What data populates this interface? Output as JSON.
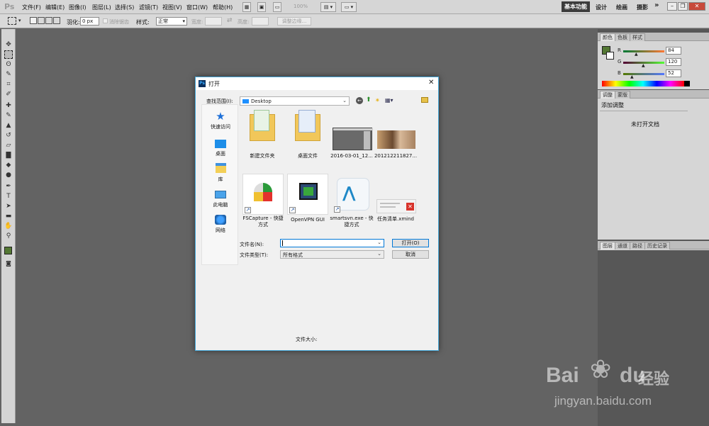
{
  "app": {
    "logo": "Ps",
    "menus": [
      "文件(F)",
      "编辑(E)",
      "图像(I)",
      "图层(L)",
      "选择(S)",
      "滤镜(T)",
      "视图(V)",
      "窗口(W)",
      "帮助(H)"
    ],
    "zoom": "100%",
    "workspaces": {
      "active": "基本功能",
      "items": [
        "设计",
        "绘画",
        "摄影"
      ],
      "more": "»"
    }
  },
  "options": {
    "feather_label": "羽化:",
    "feather_value": "0 px",
    "antialias_label": "消除锯齿",
    "style_label": "样式:",
    "style_value": "正常",
    "width_label": "宽度:",
    "height_label": "高度:",
    "refine_edge": "调整边缘..."
  },
  "panels": {
    "color": {
      "tabs": [
        "颜色",
        "色板",
        "样式"
      ],
      "r": "84",
      "g": "120",
      "b": "52",
      "foreground_color": "#547834"
    },
    "adjustments": {
      "tabs": [
        "调整",
        "蒙版"
      ],
      "heading": "添加调整",
      "empty_message": "未打开文档"
    },
    "layers": {
      "tabs": [
        "图层",
        "通道",
        "路径",
        "历史记录"
      ]
    }
  },
  "dialog": {
    "title": "打开",
    "lookin_label": "查找范围(I):",
    "lookin_value": "Desktop",
    "places": [
      {
        "label": "快速访问",
        "icon": "star-icon"
      },
      {
        "label": "桌面",
        "icon": "desktop-icon"
      },
      {
        "label": "库",
        "icon": "library-icon"
      },
      {
        "label": "此电脑",
        "icon": "computer-icon"
      },
      {
        "label": "网络",
        "icon": "network-icon"
      }
    ],
    "files": [
      {
        "label": "新建文件夹",
        "type": "folder"
      },
      {
        "label": "桌面文件",
        "type": "folder"
      },
      {
        "label": "2016-03-01_12...",
        "type": "screenshot"
      },
      {
        "label": "201212211827...",
        "type": "photo"
      },
      {
        "label": "FSCapture - 快捷方式",
        "type": "shortcut"
      },
      {
        "label": "OpenVPN GUI",
        "type": "shortcut"
      },
      {
        "label": "smartsvn.exe - 快捷方式",
        "type": "shortcut"
      },
      {
        "label": "任务清单.xmind",
        "type": "xmind"
      }
    ],
    "filename_label": "文件名(N):",
    "filename_value": "",
    "filetype_label": "文件类型(T):",
    "filetype_value": "所有格式",
    "open_button": "打开(O)",
    "cancel_button": "取消",
    "filesize_label": "文件大小:"
  },
  "watermark": {
    "brand": "Bai",
    "brand2": "du",
    "cn": "经验",
    "url": "jingyan.baidu.com"
  }
}
